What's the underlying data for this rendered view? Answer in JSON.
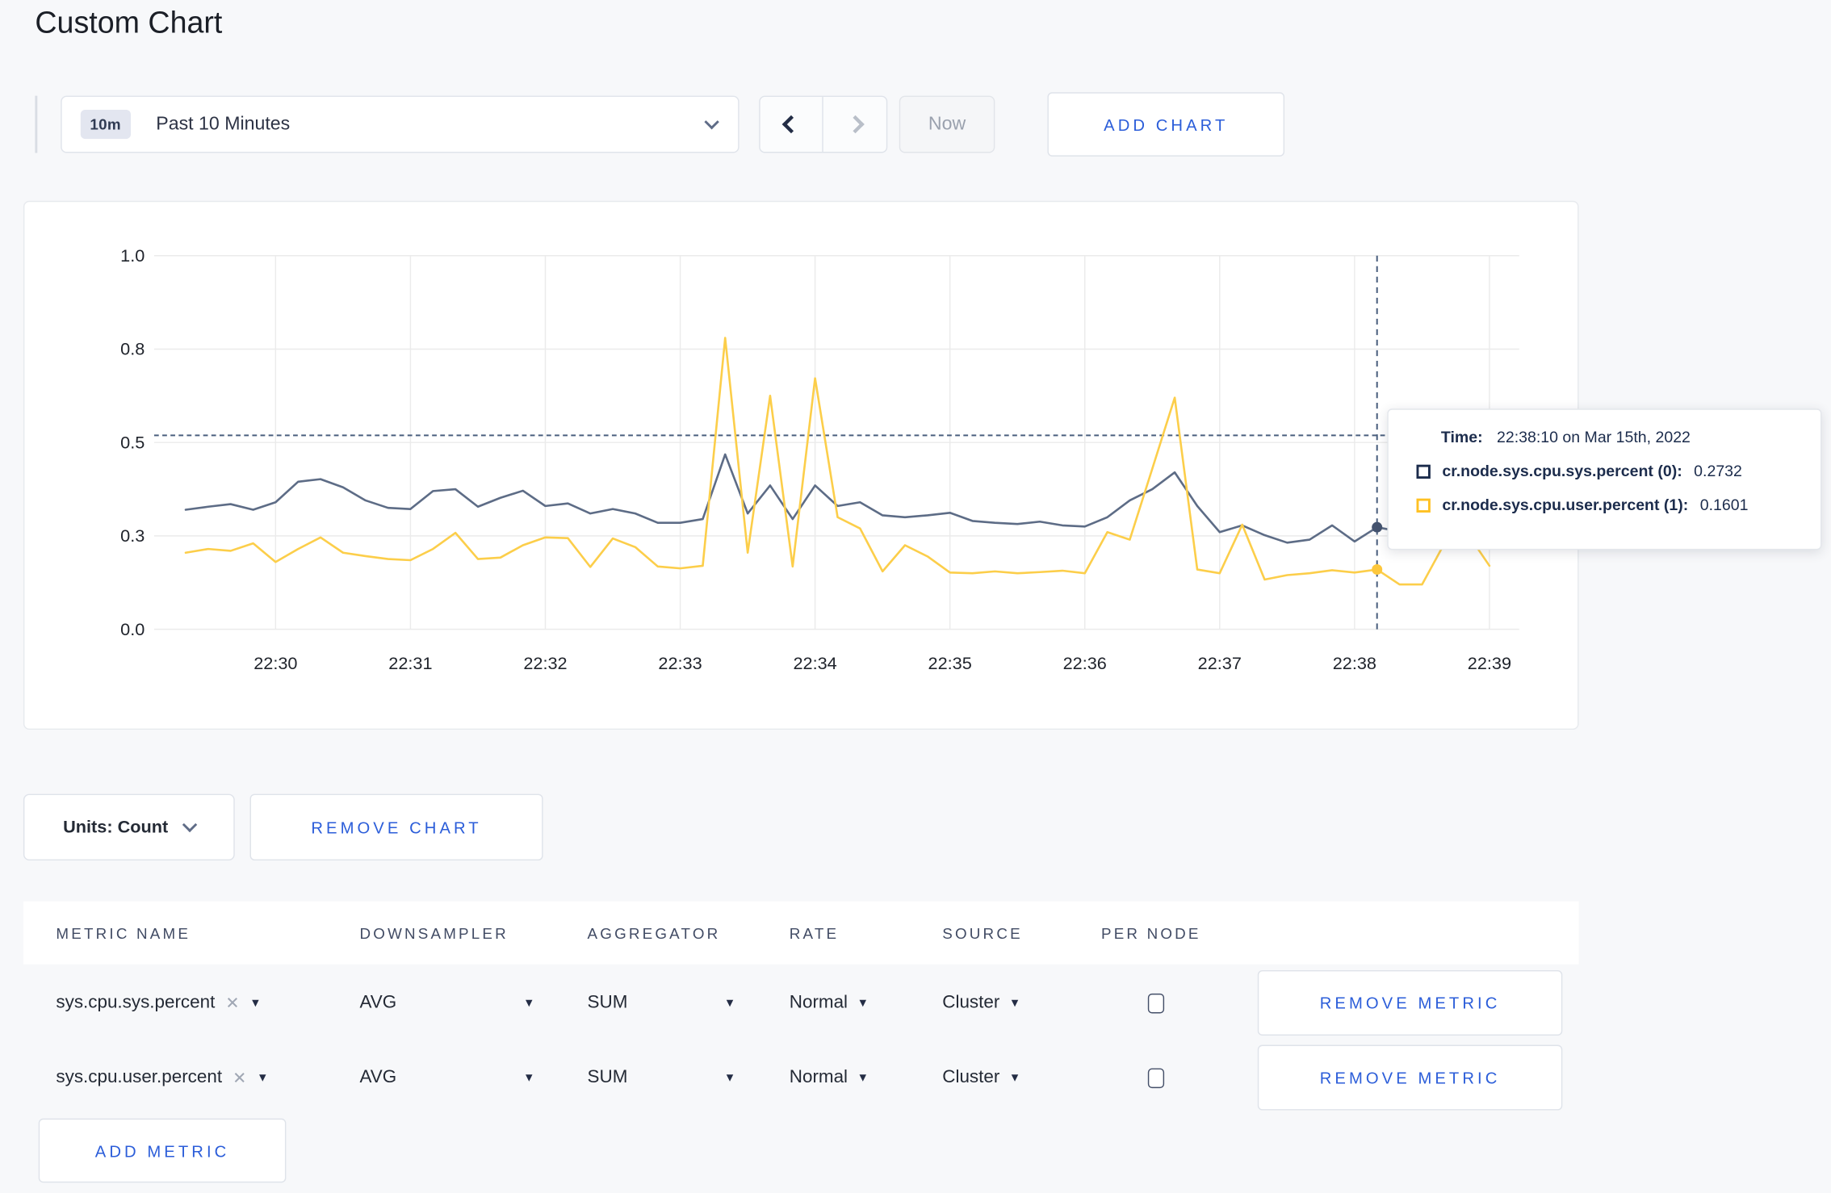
{
  "page": {
    "title": "Custom Chart",
    "accent_blue": "#2b5dd9",
    "background": "#f7f8fa"
  },
  "toolbar": {
    "time_window_badge": "10m",
    "time_window_label": "Past 10 Minutes",
    "back_icon": "chevron-left",
    "forward_icon": "chevron-right",
    "now_label": "Now",
    "add_chart_label": "ADD CHART"
  },
  "chart_data": {
    "type": "line",
    "title": "",
    "xlabel": "",
    "ylabel": "",
    "ylim": [
      0,
      1
    ],
    "grid": true,
    "legend_position": "tooltip",
    "y_tick_values": [
      0,
      0.25,
      0.5,
      0.75,
      1.0
    ],
    "y_tick_labels": [
      "0.0",
      "0.3",
      "0.5",
      "0.8",
      "1.0"
    ],
    "x_ticks": [
      {
        "t": 40,
        "label": "22:30"
      },
      {
        "t": 100,
        "label": "22:31"
      },
      {
        "t": 160,
        "label": "22:32"
      },
      {
        "t": 220,
        "label": "22:33"
      },
      {
        "t": 280,
        "label": "22:34"
      },
      {
        "t": 340,
        "label": "22:35"
      },
      {
        "t": 400,
        "label": "22:36"
      },
      {
        "t": 460,
        "label": "22:37"
      },
      {
        "t": 520,
        "label": "22:38"
      },
      {
        "t": 580,
        "label": "22:39"
      }
    ],
    "x_start_time": "22:29:20",
    "sample_interval_seconds": 10,
    "crosshair": {
      "time": "22:38:10",
      "t_seconds": 530,
      "hline_value": 0.519
    },
    "series": [
      {
        "name": "cr.node.sys.cpu.sys.percent (0)",
        "color": "#5d6c86",
        "dot_color": "#44536f",
        "values": [
          0.32,
          0.328,
          0.335,
          0.32,
          0.34,
          0.395,
          0.402,
          0.38,
          0.345,
          0.325,
          0.322,
          0.37,
          0.375,
          0.328,
          0.352,
          0.371,
          0.33,
          0.337,
          0.31,
          0.322,
          0.31,
          0.285,
          0.285,
          0.295,
          0.468,
          0.31,
          0.385,
          0.295,
          0.385,
          0.33,
          0.34,
          0.305,
          0.3,
          0.305,
          0.312,
          0.29,
          0.285,
          0.282,
          0.288,
          0.278,
          0.275,
          0.3,
          0.345,
          0.375,
          0.42,
          0.33,
          0.26,
          0.278,
          0.252,
          0.232,
          0.24,
          0.278,
          0.235,
          0.2732,
          0.262,
          0.285,
          0.295,
          0.298,
          0.3
        ]
      },
      {
        "name": "cr.node.sys.cpu.user.percent (1)",
        "color": "#fcce4a",
        "dot_color": "#fdc73c",
        "values": [
          0.205,
          0.215,
          0.21,
          0.23,
          0.18,
          0.215,
          0.246,
          0.205,
          0.196,
          0.188,
          0.185,
          0.215,
          0.258,
          0.188,
          0.192,
          0.225,
          0.246,
          0.244,
          0.167,
          0.243,
          0.22,
          0.168,
          0.163,
          0.17,
          0.78,
          0.205,
          0.625,
          0.168,
          0.672,
          0.3,
          0.27,
          0.155,
          0.225,
          0.195,
          0.152,
          0.15,
          0.155,
          0.15,
          0.153,
          0.157,
          0.15,
          0.26,
          0.24,
          0.43,
          0.62,
          0.16,
          0.15,
          0.28,
          0.133,
          0.145,
          0.15,
          0.158,
          0.152,
          0.1601,
          0.12,
          0.12,
          0.23,
          0.258,
          0.17
        ]
      }
    ]
  },
  "tooltip": {
    "time_label": "Time:",
    "time_value": "22:38:10 on Mar 15th, 2022",
    "entries": [
      {
        "name": "cr.node.sys.cpu.sys.percent (0):",
        "value": "0.2732",
        "color": "#1c2c4c"
      },
      {
        "name": "cr.node.sys.cpu.user.percent (1):",
        "value": "0.1601",
        "color": "#ffc123"
      }
    ]
  },
  "chart_footer": {
    "units_label": "Units: Count",
    "remove_chart_label": "REMOVE CHART"
  },
  "metrics_table": {
    "headers": [
      "METRIC NAME",
      "DOWNSAMPLER",
      "AGGREGATOR",
      "RATE",
      "SOURCE",
      "PER NODE"
    ],
    "rows": [
      {
        "metric": "sys.cpu.sys.percent",
        "downsampler": "AVG",
        "aggregator": "SUM",
        "rate": "Normal",
        "source": "Cluster",
        "per_node_checked": false,
        "remove_label": "REMOVE METRIC"
      },
      {
        "metric": "sys.cpu.user.percent",
        "downsampler": "AVG",
        "aggregator": "SUM",
        "rate": "Normal",
        "source": "Cluster",
        "per_node_checked": false,
        "remove_label": "REMOVE METRIC"
      }
    ],
    "add_metric_label": "ADD METRIC",
    "close_icon": "✕",
    "caret_icon": "▼"
  }
}
